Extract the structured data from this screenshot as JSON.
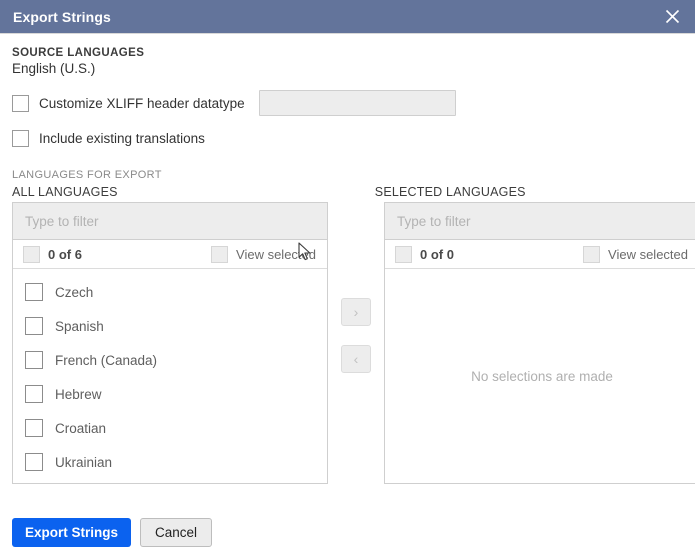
{
  "dialog": {
    "title": "Export Strings",
    "close_icon": "close-icon"
  },
  "source": {
    "label": "SOURCE LANGUAGES",
    "value": "English (U.S.)"
  },
  "options": [
    {
      "label": "Customize XLIFF header datatype",
      "checked": false,
      "has_input": true
    },
    {
      "label": "Include existing translations",
      "checked": false,
      "has_input": false
    }
  ],
  "xliff_datatype_input": {
    "value": "",
    "placeholder": ""
  },
  "export_section": {
    "label": "LANGUAGES FOR EXPORT"
  },
  "all_languages": {
    "heading": "ALL LANGUAGES",
    "filter_placeholder": "Type to filter",
    "filter_value": "",
    "count_label": "0 of 6",
    "view_selected_label": "View selected",
    "select_all_checked": false,
    "view_selected_checked": false,
    "items": [
      {
        "label": "Czech",
        "checked": false
      },
      {
        "label": "Spanish",
        "checked": false
      },
      {
        "label": "French (Canada)",
        "checked": false
      },
      {
        "label": "Hebrew",
        "checked": false
      },
      {
        "label": "Croatian",
        "checked": false
      },
      {
        "label": "Ukrainian",
        "checked": false
      }
    ]
  },
  "selected_languages": {
    "heading": "SELECTED LANGUAGES",
    "filter_placeholder": "Type to filter",
    "filter_value": "",
    "count_label": "0 of 0",
    "view_selected_label": "View selected",
    "select_all_checked": false,
    "view_selected_checked": false,
    "items": [],
    "empty_message": "No selections are made"
  },
  "transfer_buttons": {
    "move_right_icon": "chevron-right-icon",
    "move_left_icon": "chevron-left-icon",
    "move_right_glyph": "›",
    "move_left_glyph": "‹",
    "disabled": true
  },
  "footer": {
    "primary_label": "Export Strings",
    "secondary_label": "Cancel"
  },
  "colors": {
    "titlebar": "#63749b",
    "primary_button": "#0b62ef",
    "panel_border": "#cfcfcf",
    "field_fill": "#ededed"
  }
}
